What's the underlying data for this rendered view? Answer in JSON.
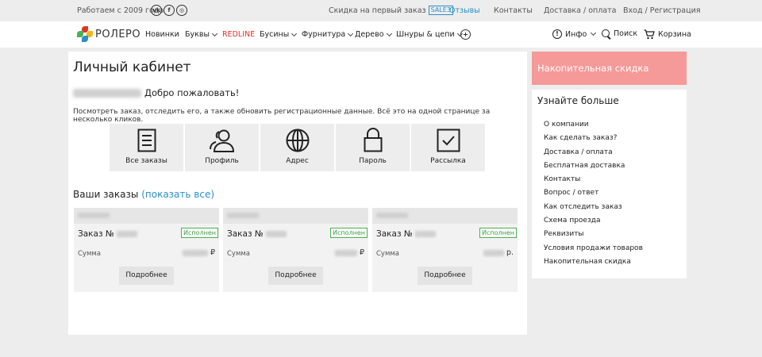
{
  "topbar": {
    "since": "Работаем с 2009 года",
    "social": [
      "vk-icon",
      "facebook-icon",
      "instagram-icon"
    ],
    "promo_text": "Скидка на первый заказ",
    "promo_code": "SALE3",
    "reviews": "Отзывы",
    "contacts": "Контакты",
    "delivery": "Доставка / оплата",
    "login": "Вход / Регистрация"
  },
  "nav": {
    "logo": "РОЛЕРО",
    "items": [
      "Новинки",
      "Буквы",
      "REDLINE",
      "Бусины",
      "Фурнитура",
      "Дерево",
      "Шнуры & цепи"
    ],
    "info": "Инфо",
    "search": "Поиск",
    "cart": "Корзина"
  },
  "main": {
    "title": "Личный кабинет",
    "welcome": "Добро пожаловать!",
    "description": "Посмотреть заказ, отследить его, а также обновить регистрационные данные. Всё это на одной странице за несколько кликов.",
    "tiles": [
      "Все заказы",
      "Профиль",
      "Адрес",
      "Пароль",
      "Рассылка"
    ],
    "orders_heading": "Ваши заказы",
    "orders_link": "(показать все)",
    "order_prefix": "Заказ №",
    "sum_label": "Сумма",
    "more_label": "Подробнее",
    "orders": [
      {
        "status": "Исполнен",
        "currency": "₽"
      },
      {
        "status": "Исполнен",
        "currency": "₽"
      },
      {
        "status": "Исполнен",
        "currency": "р."
      }
    ]
  },
  "sidebar": {
    "discount": "Накопительная скидка",
    "heading": "Узнайте больше",
    "links": [
      "О компании",
      "Как сделать заказ?",
      "Доставка / оплата",
      "Бесплатная доставка",
      "Контакты",
      "Вопрос / ответ",
      "Как отследить заказ",
      "Схема проезда",
      "Реквизиты",
      "Условия продажи товаров",
      "Накопительная скидка"
    ]
  },
  "colors": {
    "accent": "#2b8fc8",
    "redline": "#e2332b",
    "discount_bg": "#f59a98",
    "status_green": "#4caf50"
  }
}
